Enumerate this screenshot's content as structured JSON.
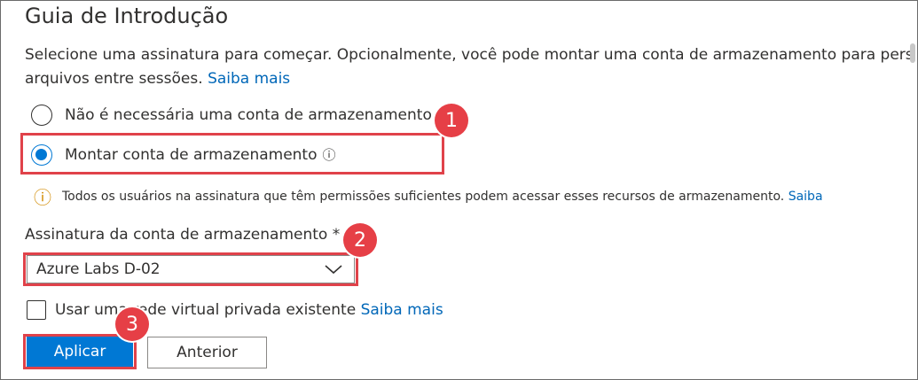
{
  "title": "Guia de Introdução",
  "description": {
    "line1": "Selecione uma assinatura para começar. Opcionalmente, você pode montar uma conta de armazenamento para persistir",
    "line2": "arquivos entre sessões.",
    "learn_more": "Saiba mais"
  },
  "options": {
    "no_storage": {
      "label": "Não é necessária uma conta de armazenamento",
      "selected": false
    },
    "mount_storage": {
      "label": "Montar conta de armazenamento",
      "selected": true,
      "info_icon": "ⓘ"
    }
  },
  "notice": {
    "icon": "ⓘ",
    "text": "Todos os usuários na assinatura que têm permissões suficientes podem acessar esses recursos de armazenamento.",
    "link": "Saiba"
  },
  "subscription": {
    "label": "Assinatura da conta de armazenamento",
    "required_mark": "*",
    "selected_value": "Azure Labs D-02"
  },
  "vnet": {
    "label": "Usar uma rede virtual privada existente",
    "link": "Saiba mais",
    "checked": false
  },
  "buttons": {
    "apply": "Aplicar",
    "previous": "Anterior"
  },
  "annotations": {
    "step1": "1",
    "step2": "2",
    "step3": "3",
    "color": "#e0424a"
  },
  "colors": {
    "primary": "#0078d4",
    "link": "#0067b8",
    "warning": "#d18a00"
  }
}
